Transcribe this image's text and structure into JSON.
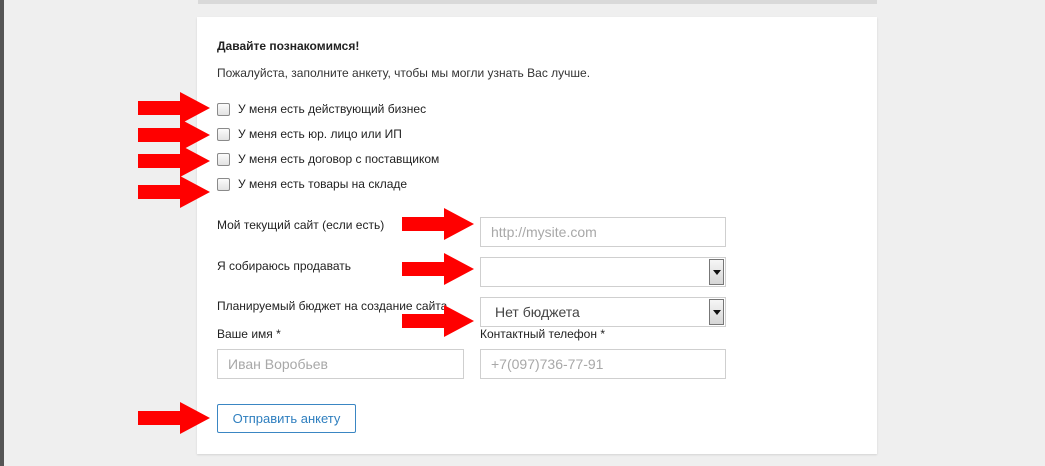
{
  "form": {
    "heading": "Давайте познакомимся!",
    "intro": "Пожалуйста, заполните анкету, чтобы мы могли узнать Вас лучше.",
    "checkboxes": [
      {
        "label": "У меня есть действующий бизнес",
        "checked": false
      },
      {
        "label": "У меня есть юр. лицо или ИП",
        "checked": false
      },
      {
        "label": "У меня есть договор с поставщиком",
        "checked": false
      },
      {
        "label": "У меня есть товары на складе",
        "checked": false
      }
    ],
    "site": {
      "label": "Мой текущий сайт (если есть)",
      "placeholder": "http://mysite.com",
      "value": ""
    },
    "sell": {
      "label": "Я собираюсь продавать",
      "value": ""
    },
    "budget": {
      "label": "Планируемый бюджет на создание сайта",
      "value": "Нет бюджета"
    },
    "name": {
      "label": "Ваше имя *",
      "placeholder": "Иван Воробьев",
      "value": ""
    },
    "phone": {
      "label": "Контактный телефон *",
      "placeholder": "+7(097)736-77-91",
      "value": ""
    },
    "submit_label": "Отправить анкету"
  },
  "annotations": {
    "arrow_color": "#ff0000",
    "arrow_icon": "red-arrow-right"
  },
  "colors": {
    "accent": "#3a86c3"
  }
}
